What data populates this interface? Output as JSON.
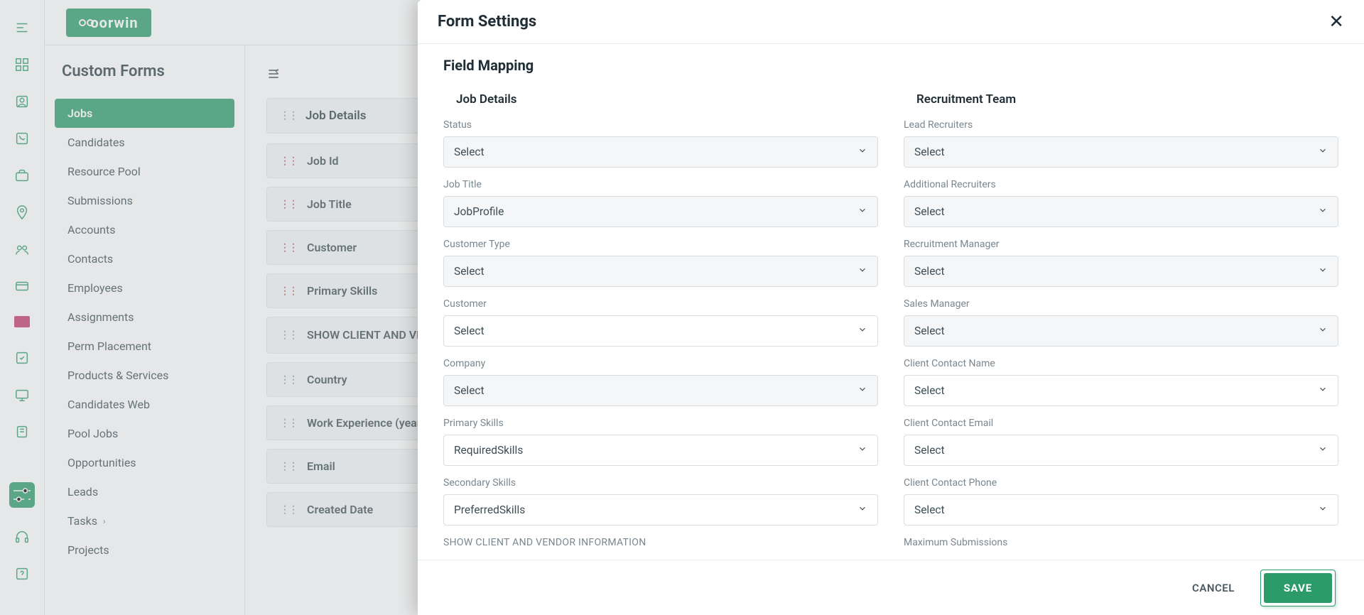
{
  "app": {
    "logo_text": "oorwin",
    "page_title": "Custom Forms"
  },
  "sidenav": {
    "items": [
      {
        "label": "Jobs",
        "active": true
      },
      {
        "label": "Candidates"
      },
      {
        "label": "Resource Pool"
      },
      {
        "label": "Submissions"
      },
      {
        "label": "Accounts"
      },
      {
        "label": "Contacts"
      },
      {
        "label": "Employees"
      },
      {
        "label": "Assignments"
      },
      {
        "label": "Perm Placement"
      },
      {
        "label": "Products & Services"
      },
      {
        "label": "Candidates Web"
      },
      {
        "label": "Pool Jobs"
      },
      {
        "label": "Opportunities"
      },
      {
        "label": "Leads"
      },
      {
        "label": "Tasks",
        "chevron": true
      },
      {
        "label": "Projects"
      }
    ]
  },
  "builder": {
    "section_title": "Job Details",
    "fields": [
      {
        "label": "Job Id",
        "required": true
      },
      {
        "label": "Job Title",
        "required": true
      },
      {
        "label": "Customer",
        "required": true
      },
      {
        "label": "Primary Skills",
        "required": true
      },
      {
        "label": "SHOW CLIENT AND VENDOR INFORMATION",
        "required": false,
        "multiline": true
      },
      {
        "label": "Country",
        "required": false
      },
      {
        "label": "Work Experience (years)",
        "required": false
      },
      {
        "label": "Email",
        "required": false
      },
      {
        "label": "Created Date",
        "required": false
      }
    ]
  },
  "modal": {
    "title": "Form Settings",
    "section": "Field Mapping",
    "left_heading": "Job Details",
    "right_heading": "Recruitment Team",
    "select_placeholder": "Select",
    "left_fields": [
      {
        "label": "Status",
        "value": "Select",
        "grey": true
      },
      {
        "label": "Job Title",
        "value": "JobProfile",
        "grey": true
      },
      {
        "label": "Customer Type",
        "value": "Select",
        "grey": true
      },
      {
        "label": "Customer",
        "value": "Select",
        "grey": false
      },
      {
        "label": "Company",
        "value": "Select",
        "grey": true
      },
      {
        "label": "Primary Skills",
        "value": "RequiredSkills",
        "grey": false
      },
      {
        "label": "Secondary Skills",
        "value": "PreferredSkills",
        "grey": false
      },
      {
        "label": "SHOW CLIENT AND VENDOR INFORMATION",
        "value": "",
        "upper": true,
        "noselect": true
      }
    ],
    "right_fields": [
      {
        "label": "Lead Recruiters",
        "value": "Select",
        "grey": true
      },
      {
        "label": "Additional Recruiters",
        "value": "Select",
        "grey": true
      },
      {
        "label": "Recruitment Manager",
        "value": "Select",
        "grey": true
      },
      {
        "label": "Sales Manager",
        "value": "Select",
        "grey": true
      },
      {
        "label": "Client Contact Name",
        "value": "Select",
        "grey": false
      },
      {
        "label": "Client Contact Email",
        "value": "Select",
        "grey": false
      },
      {
        "label": "Client Contact Phone",
        "value": "Select",
        "grey": false
      },
      {
        "label": "Maximum Submissions",
        "value": "",
        "noselect": true
      }
    ],
    "cancel": "CANCEL",
    "save": "SAVE"
  }
}
